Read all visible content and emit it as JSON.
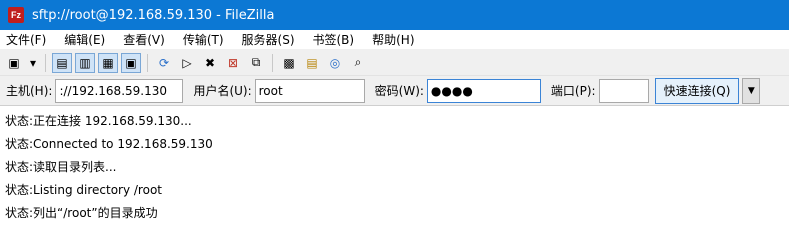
{
  "window": {
    "title": "sftp://root@192.168.59.130 - FileZilla",
    "app_icon": "Fz"
  },
  "menu": [
    "文件(F)",
    "编辑(E)",
    "查看(V)",
    "传输(T)",
    "服务器(S)",
    "书签(B)",
    "帮助(H)"
  ],
  "toolbar": {
    "icons": [
      {
        "name": "site-manager-icon",
        "glyph": "▣"
      },
      {
        "name": "dropdown-arrow-icon",
        "glyph": "▾"
      },
      {
        "name": "message-log-icon",
        "glyph": "▤",
        "active": true
      },
      {
        "name": "local-tree-icon",
        "glyph": "▥",
        "active": true
      },
      {
        "name": "remote-tree-icon",
        "glyph": "▦",
        "active": true
      },
      {
        "name": "transfer-queue-icon",
        "glyph": "▣",
        "active": true
      },
      {
        "name": "refresh-icon",
        "glyph": "⟳"
      },
      {
        "name": "process-queue-icon",
        "glyph": "▷"
      },
      {
        "name": "cancel-icon",
        "glyph": "✖"
      },
      {
        "name": "disconnect-icon",
        "glyph": "⊠"
      },
      {
        "name": "reconnect-icon",
        "glyph": "⧉"
      },
      {
        "name": "filter-icon",
        "glyph": "▩"
      },
      {
        "name": "compare-icon",
        "glyph": "▤"
      },
      {
        "name": "sync-browse-icon",
        "glyph": "◎"
      },
      {
        "name": "search-icon",
        "glyph": "⌕"
      }
    ]
  },
  "quickconnect": {
    "host_label": "主机(H):",
    "host_value": "://192.168.59.130",
    "user_label": "用户名(U):",
    "user_value": "root",
    "pass_label": "密码(W):",
    "pass_value": "●●●●",
    "port_label": "端口(P):",
    "port_value": "",
    "connect_label": "快速连接(Q)"
  },
  "log": [
    {
      "prefix": "状态:",
      "text": "正在连接 192.168.59.130..."
    },
    {
      "prefix": "状态:",
      "text": "Connected to 192.168.59.130"
    },
    {
      "prefix": "状态:",
      "text": "读取目录列表..."
    },
    {
      "prefix": "状态:",
      "text": "Listing directory /root"
    },
    {
      "prefix": "状态:",
      "text": "列出“/root”的目录成功"
    }
  ]
}
